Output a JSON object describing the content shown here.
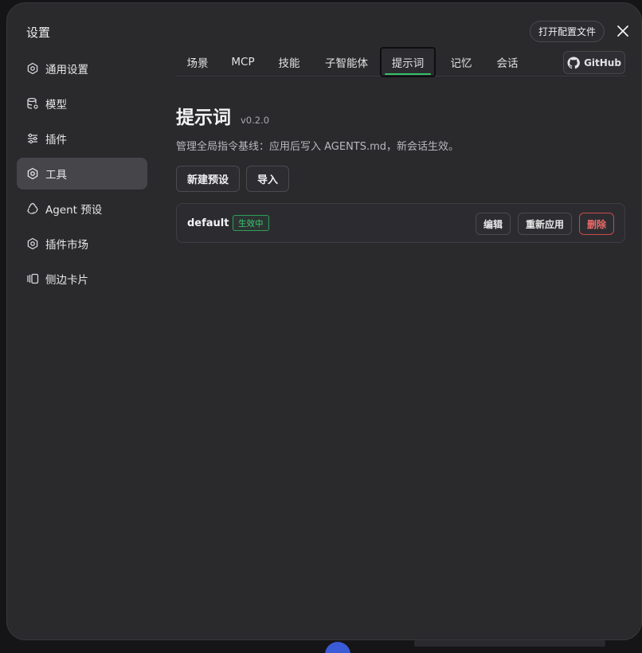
{
  "dialog": {
    "title": "设置",
    "open_config_label": "打开配置文件",
    "close_glyph": "✕"
  },
  "sidebar": {
    "items": [
      {
        "label": "通用设置",
        "icon": "gear-icon"
      },
      {
        "label": "模型",
        "icon": "database-gear-icon"
      },
      {
        "label": "插件",
        "icon": "sliders-icon"
      },
      {
        "label": "工具",
        "icon": "gear-icon",
        "active": true
      },
      {
        "label": "Agent 预设",
        "icon": "recycle-icon"
      },
      {
        "label": "插件市场",
        "icon": "gear-icon"
      },
      {
        "label": "侧边卡片",
        "icon": "card-stack-icon"
      }
    ]
  },
  "tabs": {
    "items": [
      {
        "label": "场景"
      },
      {
        "label": "MCP"
      },
      {
        "label": "技能"
      },
      {
        "label": "子智能体"
      },
      {
        "label": "提示词",
        "active": true
      },
      {
        "label": "记忆"
      },
      {
        "label": "会话"
      }
    ],
    "github_label": "GitHub"
  },
  "main": {
    "heading": "提示词",
    "version": "v0.2.0",
    "description": "管理全局指令基线：应用后写入 AGENTS.md，新会话生效。",
    "new_preset_label": "新建预设",
    "import_label": "导入"
  },
  "preset": {
    "name": "default",
    "status": "生效中",
    "edit_label": "编辑",
    "reapply_label": "重新应用",
    "delete_label": "删除"
  },
  "colors": {
    "dialog_bg": "#2a2a2d",
    "active_item_bg": "#45454a",
    "accent_green": "#34c26a",
    "danger_red": "#f06a6a"
  }
}
